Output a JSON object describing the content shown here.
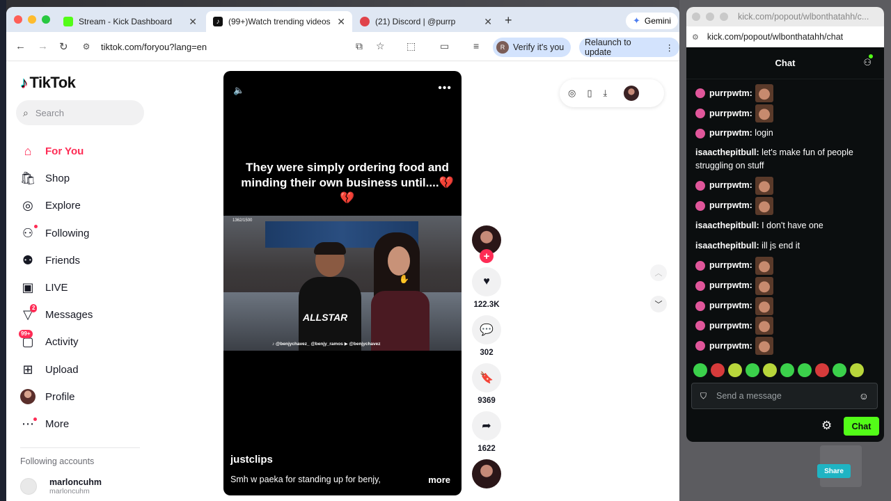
{
  "browser": {
    "tabs": [
      {
        "title": "Stream - Kick Dashboard"
      },
      {
        "title": "(99+)Watch trending videos f"
      },
      {
        "title": "(21) Discord | @purrp"
      }
    ],
    "gemini_label": "Gemini",
    "url": "tiktok.com/foryou?lang=en",
    "verify_label": "Verify it's you",
    "relaunch_label": "Relaunch to update"
  },
  "tiktok": {
    "logo": "TikTok",
    "search_placeholder": "Search",
    "nav": [
      {
        "label": "For You",
        "icon": "home-icon"
      },
      {
        "label": "Shop",
        "icon": "shop-icon"
      },
      {
        "label": "Explore",
        "icon": "compass-icon"
      },
      {
        "label": "Following",
        "icon": "following-icon"
      },
      {
        "label": "Friends",
        "icon": "friends-icon"
      },
      {
        "label": "LIVE",
        "icon": "live-icon"
      },
      {
        "label": "Messages",
        "icon": "messages-icon",
        "badge": "2"
      },
      {
        "label": "Activity",
        "icon": "activity-icon",
        "badge": "99+"
      },
      {
        "label": "Upload",
        "icon": "upload-icon"
      },
      {
        "label": "Profile",
        "icon": "profile-avatar"
      },
      {
        "label": "More",
        "icon": "more-icon"
      }
    ],
    "following_accounts_title": "Following accounts",
    "following_accounts": [
      {
        "name": "marloncuhm",
        "username": "marloncuhm"
      }
    ],
    "video": {
      "caption": "They were simply ordering food and minding their own business until....💔💔",
      "frame_counter": "1362/1500",
      "socials": "♪ @benjychavez_  @benjy_ramos  ▶ @benjychavez",
      "shirt_text": "ALLSTAR",
      "author": "justclips",
      "description": "Smh w paeka for standing up for benjy,",
      "more_label": "more",
      "likes": "122.3K",
      "comments": "302",
      "saves": "9369",
      "shares": "1622"
    }
  },
  "chat_popout": {
    "window_title": "kick.com/popout/wlbonthatahh/c...",
    "url": "kick.com/popout/wlbonthatahh/chat",
    "header": "Chat",
    "messages": [
      {
        "user": "purrpwtm:",
        "text": "",
        "emote": true
      },
      {
        "user": "purrpwtm:",
        "text": "",
        "emote": true
      },
      {
        "user": "purrpwtm:",
        "text": "login",
        "emote": false
      },
      {
        "user": "isaacthepitbull:",
        "text": "let's make fun of people struggling on stuff",
        "emote": false
      },
      {
        "user": "purrpwtm:",
        "text": "",
        "emote": true
      },
      {
        "user": "purrpwtm:",
        "text": "",
        "emote": true
      },
      {
        "user": "isaacthepitbull:",
        "text": "I don't have one",
        "emote": false
      },
      {
        "user": "isaacthepitbull:",
        "text": "ill js end it",
        "emote": false
      },
      {
        "user": "purrpwtm:",
        "text": "",
        "emote": true
      },
      {
        "user": "purrpwtm:",
        "text": "",
        "emote": true
      },
      {
        "user": "purrpwtm:",
        "text": "",
        "emote": true
      },
      {
        "user": "purrpwtm:",
        "text": "",
        "emote": true
      },
      {
        "user": "purrpwtm:",
        "text": "",
        "emote": true
      }
    ],
    "input_placeholder": "Send a message",
    "send_label": "Chat",
    "accent": "#53fc18"
  },
  "background": {
    "share_label": "Share"
  },
  "colors": {
    "tiktok_red": "#fe2c55",
    "kick_green": "#53fc18"
  }
}
